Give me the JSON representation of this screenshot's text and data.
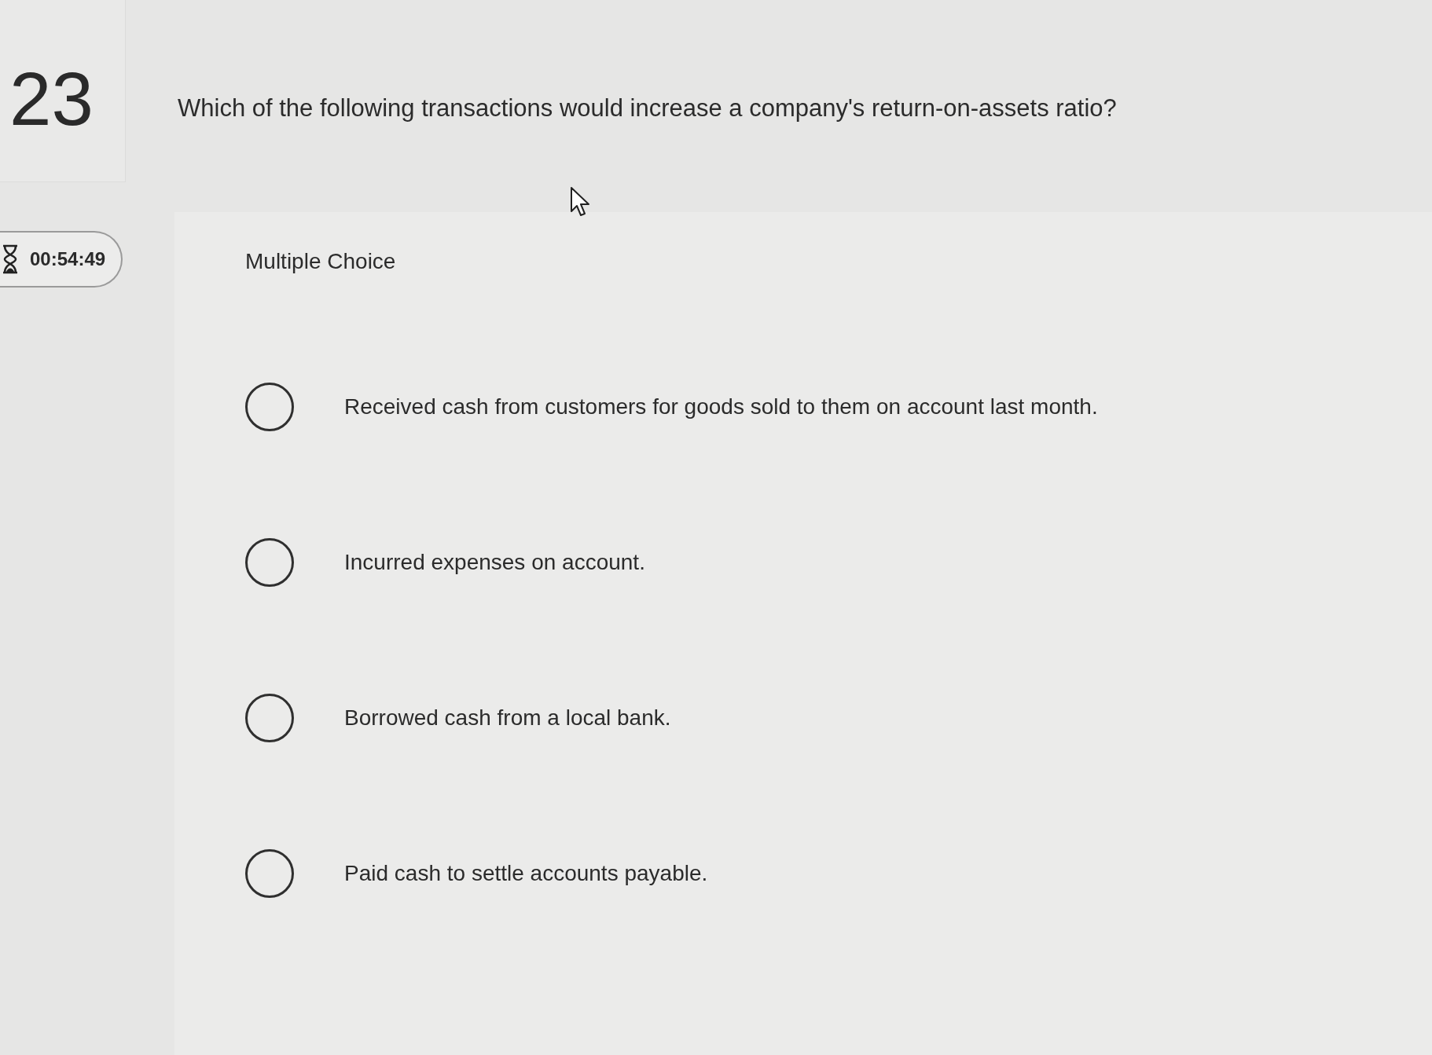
{
  "question": {
    "number": "23",
    "text": "Which of the following transactions would increase a company's return-on-assets ratio?"
  },
  "timer": {
    "time": "00:54:49"
  },
  "answer_panel": {
    "type_label": "Multiple Choice",
    "options": [
      {
        "text": "Received cash from customers for goods sold to them on account last month.",
        "selected": false
      },
      {
        "text": "Incurred expenses on account.",
        "selected": false
      },
      {
        "text": "Borrowed cash from a local bank.",
        "selected": false
      },
      {
        "text": "Paid cash to settle accounts payable.",
        "selected": false
      }
    ]
  }
}
